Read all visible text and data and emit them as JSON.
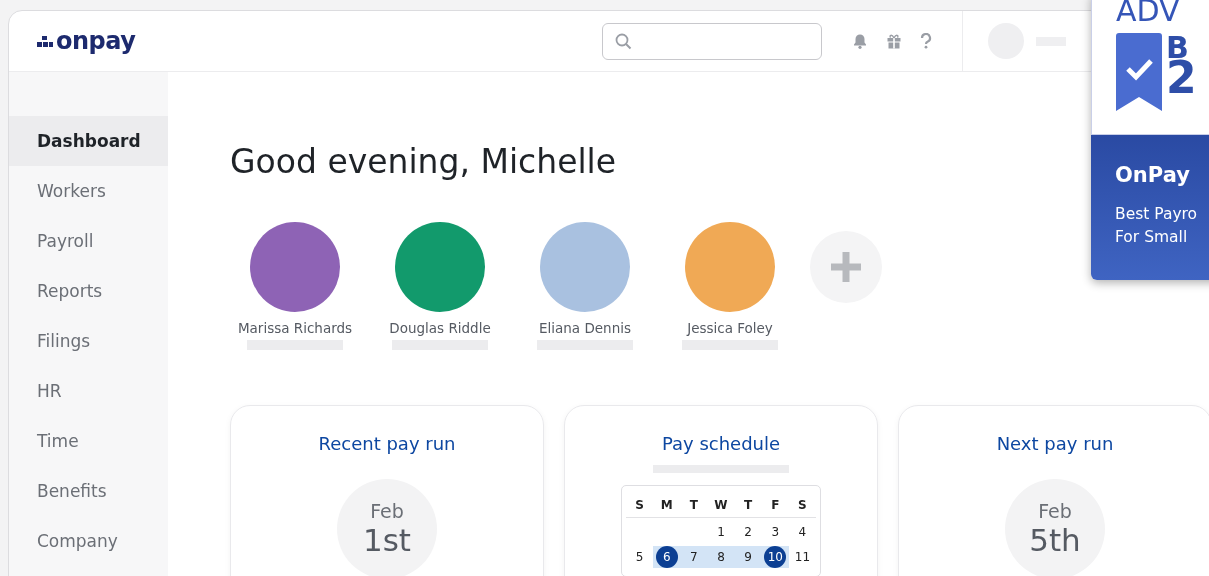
{
  "header": {
    "logo": "onpay"
  },
  "sidebar": {
    "items": [
      {
        "label": "Dashboard",
        "selected": true
      },
      {
        "label": "Workers",
        "selected": false
      },
      {
        "label": "Payroll",
        "selected": false
      },
      {
        "label": "Reports",
        "selected": false
      },
      {
        "label": "Filings",
        "selected": false
      },
      {
        "label": "HR",
        "selected": false
      },
      {
        "label": "Time",
        "selected": false
      },
      {
        "label": "Benefits",
        "selected": false
      },
      {
        "label": "Company",
        "selected": false
      }
    ]
  },
  "greeting": "Good evening, Michelle",
  "people": [
    {
      "name": "Marissa Richards",
      "color": "#8e63b5"
    },
    {
      "name": "Douglas Riddle",
      "color": "#129a6c"
    },
    {
      "name": "Eliana Dennis",
      "color": "#a9c1e0"
    },
    {
      "name": "Jessica Foley",
      "color": "#f0a955"
    }
  ],
  "cards": [
    {
      "kind": "date",
      "title": "Recent pay run",
      "month": "Feb",
      "day": "1st"
    },
    {
      "kind": "calendar",
      "title": "Pay schedule",
      "weekdays": [
        "S",
        "M",
        "T",
        "W",
        "T",
        "F",
        "S"
      ],
      "weeks": [
        [
          {
            "day": "1",
            "selected": false,
            "in_range": false
          },
          {
            "day": "2",
            "selected": false,
            "in_range": false
          },
          {
            "day": "3",
            "selected": false,
            "in_range": false
          },
          {
            "day": "4",
            "selected": false,
            "in_range": false
          }
        ],
        [
          {
            "day": "5",
            "selected": false,
            "in_range": false
          },
          {
            "day": "6",
            "selected": true,
            "in_range": true
          },
          {
            "day": "7",
            "selected": false,
            "in_range": true
          },
          {
            "day": "8",
            "selected": false,
            "in_range": true
          },
          {
            "day": "9",
            "selected": false,
            "in_range": true
          },
          {
            "day": "10",
            "selected": true,
            "in_range": true
          },
          {
            "day": "11",
            "selected": false,
            "in_range": false
          }
        ]
      ]
    },
    {
      "kind": "date",
      "title": "Next pay run",
      "month": "Feb",
      "day": "5th"
    }
  ],
  "award_badge": {
    "heading": "ADV",
    "big_text": [
      "B",
      "2"
    ],
    "brand": "OnPay",
    "caption": [
      "Best Payro",
      "For Small"
    ]
  }
}
